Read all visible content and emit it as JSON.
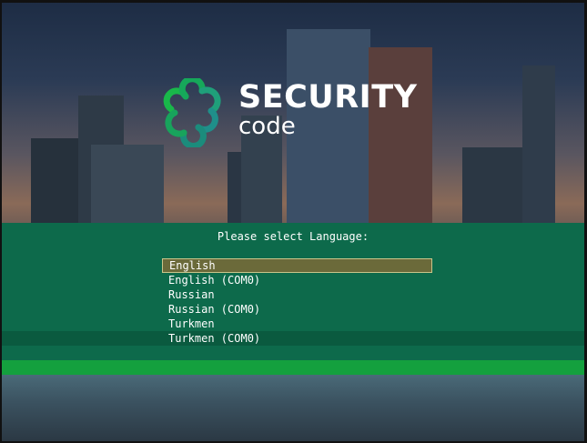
{
  "logo": {
    "brand_title": "SECURITY",
    "brand_sub": "code",
    "icon": "security-code-logo-icon",
    "colors": {
      "green": "#19b84a",
      "teal": "#1f8f8a",
      "text": "#ffffff"
    }
  },
  "dialog": {
    "prompt": "Please select Language:",
    "background": "#0d6a4b",
    "selected_index": 0,
    "languages": [
      "English",
      "English (COM0)",
      "Russian",
      "Russian (COM0)",
      "Turkmen",
      "Turkmen (COM0)"
    ]
  },
  "status_bar": {
    "color": "#14a03e"
  }
}
